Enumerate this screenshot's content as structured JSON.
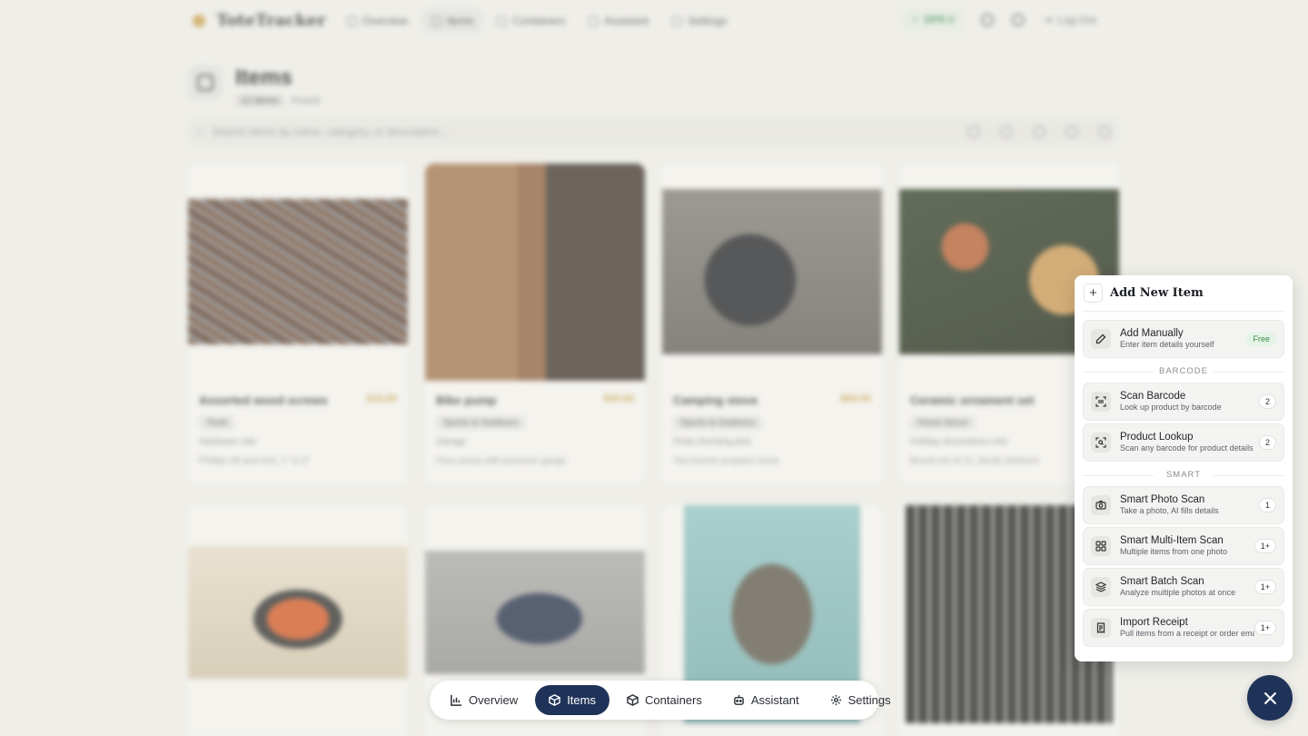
{
  "app": {
    "brand_name": "ToteTracker"
  },
  "top_nav": {
    "items": [
      {
        "label": "Overview"
      },
      {
        "label": "Items"
      },
      {
        "label": "Containers"
      },
      {
        "label": "Assistant"
      },
      {
        "label": "Settings"
      }
    ],
    "plan_badge": "DPR 2",
    "logout_label": "Log Out"
  },
  "page": {
    "title": "Items",
    "count_pill": "12 items",
    "count_suffix": "Found",
    "search_placeholder": "Search items by name, category, or description..."
  },
  "cards": [
    {
      "name": "Assorted wood screws",
      "price": "$15.00",
      "tag": "Tools",
      "location": "Hardware tote",
      "description": "Phillips #8 and #10, 1\" to 3\""
    },
    {
      "name": "Bike pump",
      "price": "$35.00",
      "tag": "Sports & Outdoors",
      "location": "Garage",
      "description": "Floor pump with pressure gauge"
    },
    {
      "name": "Camping stove",
      "price": "$65.00",
      "tag": "Sports & Outdoors",
      "location": "Petal checking pick",
      "description": "Two-burner propane stove"
    },
    {
      "name": "Ceramic ornament set",
      "price": "",
      "tag": "Home Decor",
      "location": "Holiday decorations tote",
      "description": "Boxed set of 12, family heirloom"
    },
    {
      "name": "",
      "price": "",
      "tag": "",
      "location": "",
      "description": ""
    },
    {
      "name": "",
      "price": "",
      "tag": "",
      "location": "",
      "description": ""
    },
    {
      "name": "",
      "price": "",
      "tag": "",
      "location": "",
      "description": ""
    },
    {
      "name": "",
      "price": "",
      "tag": "",
      "location": "",
      "description": ""
    }
  ],
  "bottom_nav": {
    "items": [
      {
        "label": "Overview",
        "icon": "bar-chart-icon"
      },
      {
        "label": "Items",
        "icon": "box-icon",
        "active": true
      },
      {
        "label": "Containers",
        "icon": "container-icon"
      },
      {
        "label": "Assistant",
        "icon": "robot-icon"
      },
      {
        "label": "Settings",
        "icon": "gear-icon"
      }
    ]
  },
  "add_panel": {
    "title": "Add New Item",
    "manual": {
      "label": "Add Manually",
      "sub": "Enter item details yourself",
      "badge": "Free"
    },
    "barcode_section": "BARCODE",
    "scan_barcode": {
      "label": "Scan Barcode",
      "sub": "Look up product by barcode",
      "badge": "2"
    },
    "product_lookup": {
      "label": "Product Lookup",
      "sub": "Scan any barcode for product details",
      "badge": "2"
    },
    "smart_section": "SMART",
    "smart_photo": {
      "label": "Smart Photo Scan",
      "sub": "Take a photo, AI fills details",
      "badge": "1"
    },
    "smart_multi": {
      "label": "Smart Multi-Item Scan",
      "sub": "Multiple items from one photo",
      "badge": "1+"
    },
    "smart_batch": {
      "label": "Smart Batch Scan",
      "sub": "Analyze multiple photos at once",
      "badge": "1+"
    },
    "import_receipt": {
      "label": "Import Receipt",
      "sub": "Pull items from a receipt or order email",
      "badge": "1+"
    }
  },
  "colors": {
    "accent_navy": "#1f3358",
    "free_green": "#3a8a4a",
    "price_gold": "#c49a3c"
  }
}
